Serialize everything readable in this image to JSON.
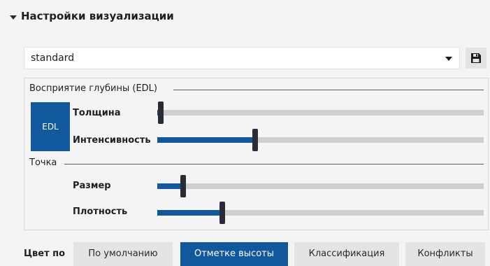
{
  "panel": {
    "title": "Настройки визуализации",
    "collapse_icon": "caret-down-icon"
  },
  "preset": {
    "selected": "standard",
    "dropdown_icon": "caret-down-icon",
    "save_icon": "floppy-disk-icon"
  },
  "edl": {
    "group_label": "Восприятие глубины (EDL)",
    "badge": "EDL",
    "sliders": [
      {
        "label": "Толщина",
        "value": 0.01
      },
      {
        "label": "Интенсивность",
        "value": 0.3
      }
    ]
  },
  "point": {
    "group_label": "Точка",
    "sliders": [
      {
        "label": "Размер",
        "value": 0.08
      },
      {
        "label": "Плотность",
        "value": 0.2
      }
    ]
  },
  "color_by": {
    "label": "Цвет по",
    "options": [
      {
        "label": "По умолчанию",
        "active": false
      },
      {
        "label": "Отметке высоты",
        "active": true
      },
      {
        "label": "Классификация",
        "active": false
      },
      {
        "label": "Конфликты",
        "active": false
      }
    ]
  },
  "colors": {
    "accent": "#11589c",
    "track": "#cfcfcf",
    "thumb": "#2b2b35",
    "button_bg": "#e4e4e4"
  }
}
